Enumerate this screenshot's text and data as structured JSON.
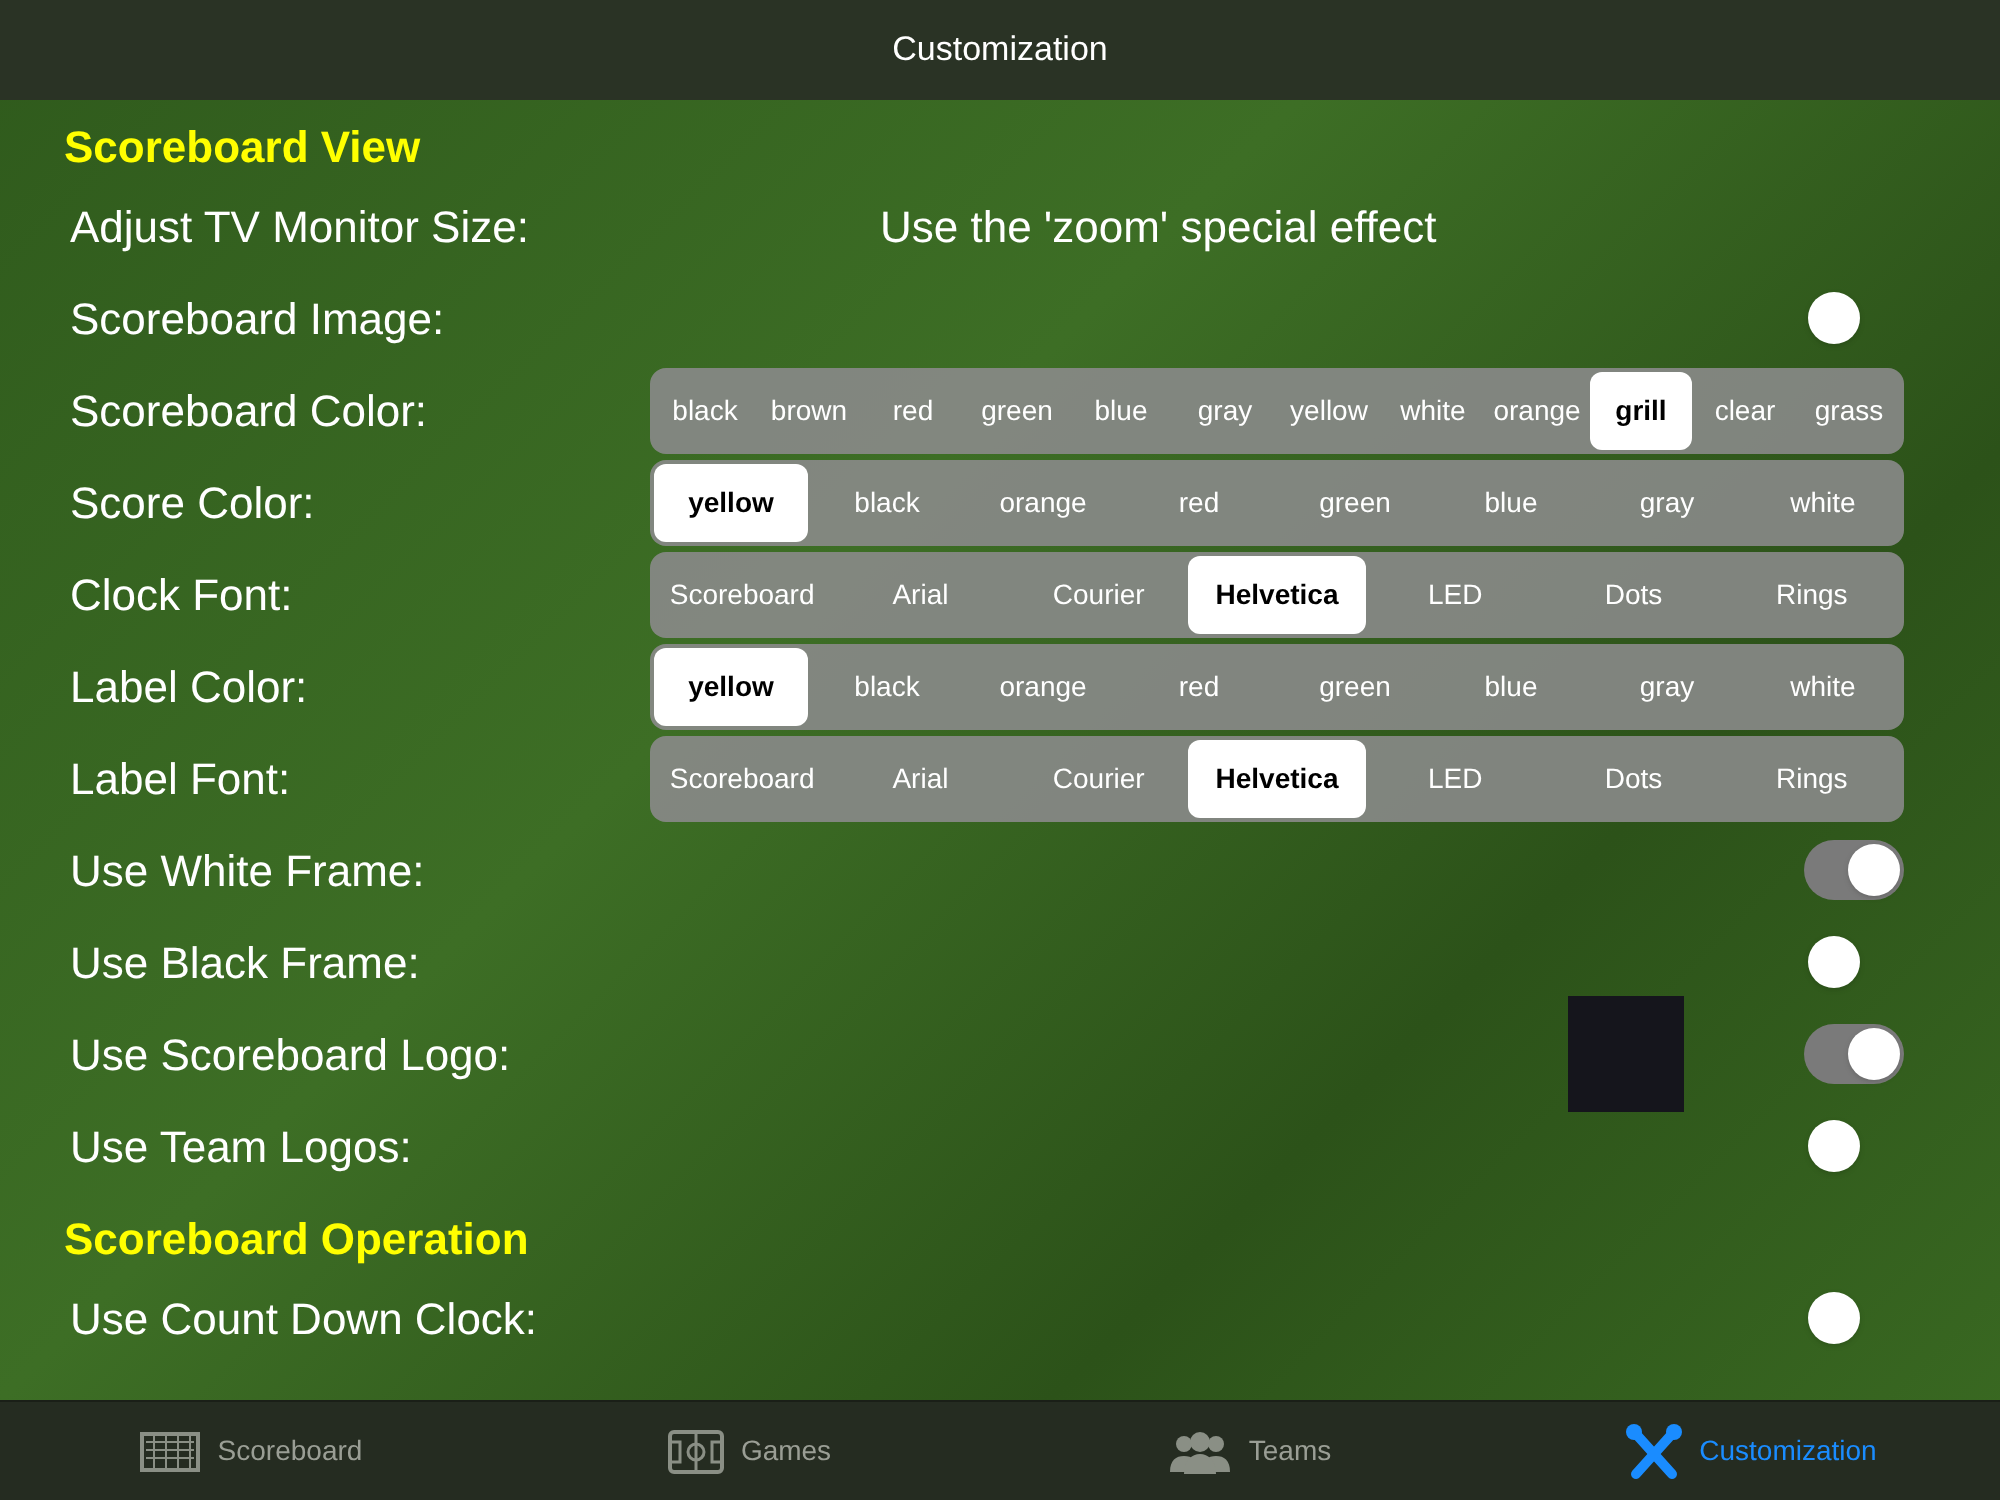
{
  "nav_bar": {
    "title": "Customization"
  },
  "sections": [
    {
      "title": "Scoreboard View",
      "rows": [
        {
          "kind": "text",
          "label": "Adjust TV Monitor Size:",
          "value": "Use the 'zoom' special effect"
        },
        {
          "kind": "toggle",
          "label": "Scoreboard Image:",
          "on": false
        },
        {
          "kind": "segmented",
          "label": "Scoreboard Color:",
          "options": [
            {
              "label": "black",
              "selected": false
            },
            {
              "label": "brown",
              "selected": false
            },
            {
              "label": "red",
              "selected": false
            },
            {
              "label": "green",
              "selected": false
            },
            {
              "label": "blue",
              "selected": false
            },
            {
              "label": "gray",
              "selected": false
            },
            {
              "label": "yellow",
              "selected": false
            },
            {
              "label": "white",
              "selected": false
            },
            {
              "label": "orange",
              "selected": false
            },
            {
              "label": "grill",
              "selected": true
            },
            {
              "label": "clear",
              "selected": false
            },
            {
              "label": "grass",
              "selected": false
            }
          ]
        },
        {
          "kind": "segmented",
          "label": "Score Color:",
          "options": [
            {
              "label": "yellow",
              "selected": true
            },
            {
              "label": "black",
              "selected": false
            },
            {
              "label": "orange",
              "selected": false
            },
            {
              "label": "red",
              "selected": false
            },
            {
              "label": "green",
              "selected": false
            },
            {
              "label": "blue",
              "selected": false
            },
            {
              "label": "gray",
              "selected": false
            },
            {
              "label": "white",
              "selected": false
            }
          ]
        },
        {
          "kind": "segmented",
          "label": "Clock Font:",
          "options": [
            {
              "label": "Scoreboard",
              "selected": false
            },
            {
              "label": "Arial",
              "selected": false
            },
            {
              "label": "Courier",
              "selected": false
            },
            {
              "label": "Helvetica",
              "selected": true
            },
            {
              "label": "LED",
              "selected": false
            },
            {
              "label": "Dots",
              "selected": false
            },
            {
              "label": "Rings",
              "selected": false
            }
          ]
        },
        {
          "kind": "segmented",
          "label": "Label Color:",
          "options": [
            {
              "label": "yellow",
              "selected": true
            },
            {
              "label": "black",
              "selected": false
            },
            {
              "label": "orange",
              "selected": false
            },
            {
              "label": "red",
              "selected": false
            },
            {
              "label": "green",
              "selected": false
            },
            {
              "label": "blue",
              "selected": false
            },
            {
              "label": "gray",
              "selected": false
            },
            {
              "label": "white",
              "selected": false
            }
          ]
        },
        {
          "kind": "segmented",
          "label": "Label Font:",
          "options": [
            {
              "label": "Scoreboard",
              "selected": false
            },
            {
              "label": "Arial",
              "selected": false
            },
            {
              "label": "Courier",
              "selected": false
            },
            {
              "label": "Helvetica",
              "selected": true
            },
            {
              "label": "LED",
              "selected": false
            },
            {
              "label": "Dots",
              "selected": false
            },
            {
              "label": "Rings",
              "selected": false
            }
          ]
        },
        {
          "kind": "toggle",
          "label": "Use White Frame:",
          "on": true
        },
        {
          "kind": "toggle",
          "label": "Use Black Frame:",
          "on": false
        },
        {
          "kind": "logo-toggle",
          "label": "Use Scoreboard Logo:",
          "on": true
        },
        {
          "kind": "toggle",
          "label": "Use Team Logos:",
          "on": false
        }
      ]
    },
    {
      "title": "Scoreboard Operation",
      "rows": [
        {
          "kind": "toggle",
          "label": "Use Count Down Clock:",
          "on": false
        }
      ]
    }
  ],
  "tab_bar": [
    {
      "label": "Scoreboard",
      "kind": "goal",
      "selected": false
    },
    {
      "label": "Games",
      "kind": "field",
      "selected": false
    },
    {
      "label": "Teams",
      "kind": "people",
      "selected": false
    },
    {
      "label": "Customization",
      "kind": "tools",
      "selected": true
    }
  ]
}
